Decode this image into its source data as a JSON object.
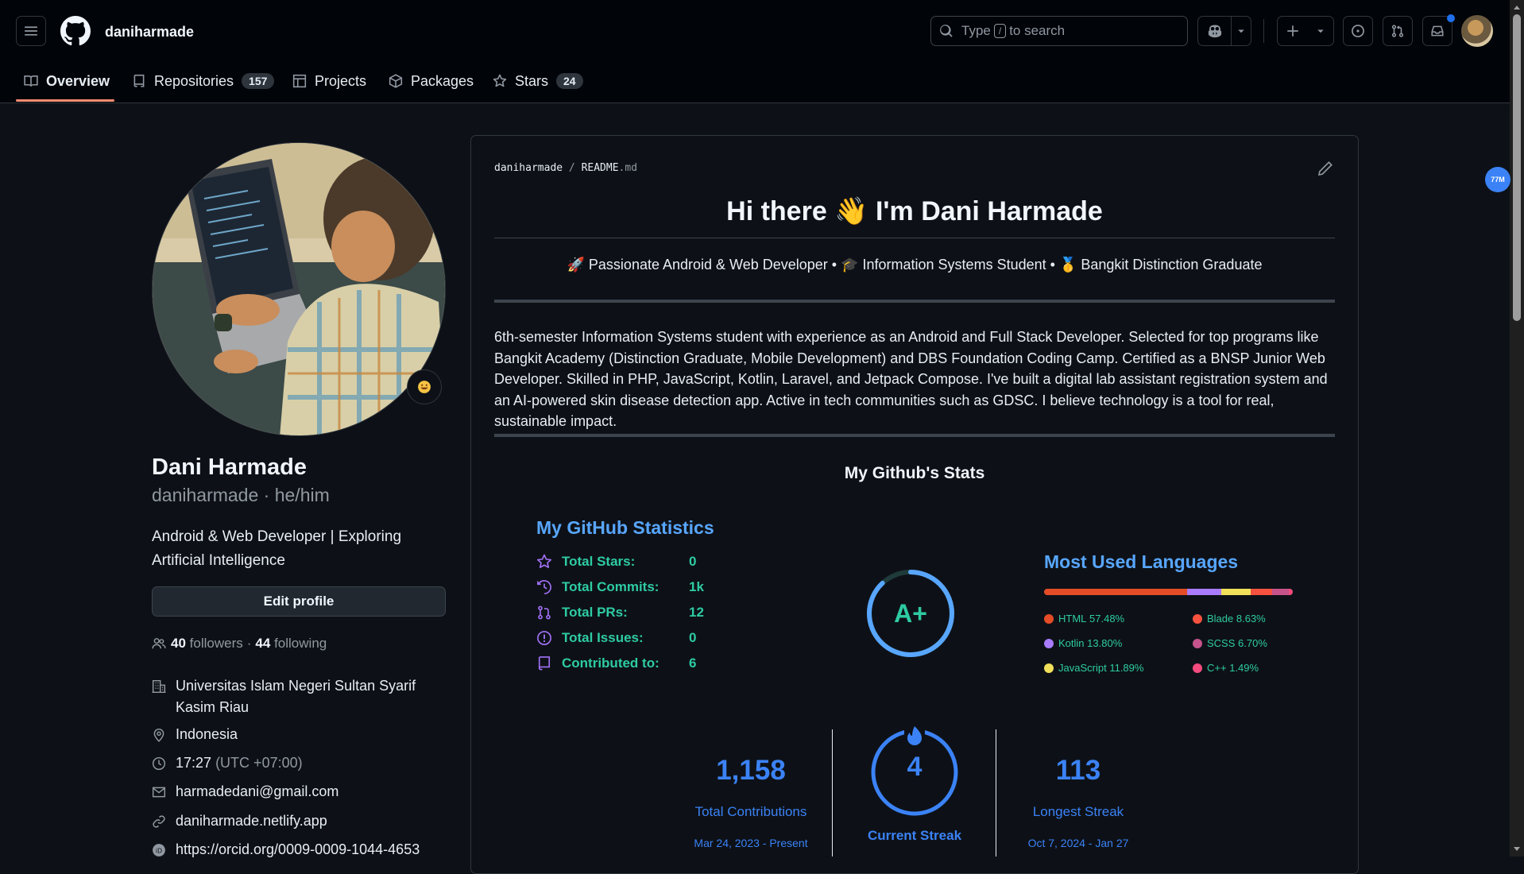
{
  "header": {
    "username": "daniharmade",
    "search_prefix": "Type",
    "search_key": "/",
    "search_suffix": "to search",
    "notification_dot_color": "#1f6feb"
  },
  "tabs": [
    {
      "label": "Overview",
      "active": true
    },
    {
      "label": "Repositories",
      "count": "157"
    },
    {
      "label": "Projects"
    },
    {
      "label": "Packages"
    },
    {
      "label": "Stars",
      "count": "24"
    }
  ],
  "profile": {
    "name": "Dani Harmade",
    "login": "daniharmade",
    "pronouns": "he/him",
    "separator": "·",
    "bio": "Android & Web Developer | Exploring Artificial Intelligence",
    "edit_label": "Edit profile",
    "followers_count": "40",
    "followers_label": "followers",
    "following_count": "44",
    "following_label": "following",
    "organization": "Universitas Islam Negeri Sultan Syarif Kasim Riau",
    "location": "Indonesia",
    "time": "17:27",
    "timezone": "(UTC +07:00)",
    "email": "harmadedani@gmail.com",
    "website": "daniharmade.netlify.app",
    "orcid": "https://orcid.org/0009-0009-1044-4653"
  },
  "readme": {
    "path_user": "daniharmade",
    "path_sep": "/",
    "path_file": "README",
    "path_ext": ".md",
    "title_left": "Hi there",
    "title_emoji": "👋",
    "title_right": "I'm Dani Harmade",
    "tagline_1": "🚀 Passionate Android & Web Developer •",
    "tagline_2": "🎓 Information Systems Student •",
    "tagline_3": "🥇 Bangkit Distinction Graduate",
    "description": "6th-semester Information Systems student with experience as an Android and Full Stack Developer. Selected for top programs like Bangkit Academy (Distinction Graduate, Mobile Development) and DBS Foundation Coding Camp. Certified as a BNSP Junior Web Developer. Skilled in PHP, JavaScript, Kotlin, Laravel, and Jetpack Compose. I've built a digital lab assistant registration system and an AI-powered skin disease detection app. Active in tech communities such as GDSC. I believe technology is a tool for real, sustainable impact.",
    "stats_heading": "My Github's Stats"
  },
  "stats_card": {
    "title": "My GitHub Statistics",
    "rows": [
      {
        "label": "Total Stars:",
        "value": "0",
        "icon": "star-icon"
      },
      {
        "label": "Total Commits:",
        "value": "1k",
        "icon": "history-icon"
      },
      {
        "label": "Total PRs:",
        "value": "12",
        "icon": "pull-request-icon"
      },
      {
        "label": "Total Issues:",
        "value": "0",
        "icon": "issue-icon"
      },
      {
        "label": "Contributed to:",
        "value": "6",
        "icon": "repo-icon"
      }
    ],
    "grade": "A+",
    "grade_progress": 0.88,
    "accent_title": "#58a6ff",
    "accent_text": "#2ecba3"
  },
  "languages_card": {
    "title": "Most Used Languages",
    "items": [
      {
        "name": "HTML",
        "percent": "57.48%",
        "value": 57.48,
        "color": "#e34c26"
      },
      {
        "name": "Kotlin",
        "percent": "13.80%",
        "value": 13.8,
        "color": "#a97bff"
      },
      {
        "name": "JavaScript",
        "percent": "11.89%",
        "value": 11.89,
        "color": "#f1e05a"
      },
      {
        "name": "Blade",
        "percent": "8.63%",
        "value": 8.63,
        "color": "#f7523f"
      },
      {
        "name": "SCSS",
        "percent": "6.70%",
        "value": 6.7,
        "color": "#c6538c"
      },
      {
        "name": "C++",
        "percent": "1.49%",
        "value": 1.49,
        "color": "#f34b7d"
      }
    ]
  },
  "streak_card": {
    "total": "1,158",
    "total_label": "Total Contributions",
    "total_range": "Mar 24, 2023 - Present",
    "current": "4",
    "current_label": "Current Streak",
    "longest": "113",
    "longest_label": "Longest Streak",
    "longest_range": "Oct 7, 2024 - Jan 27",
    "number_color": "#3b82f6"
  },
  "floating_badge": "77M"
}
